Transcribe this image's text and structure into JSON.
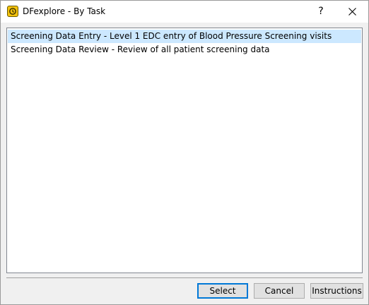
{
  "window": {
    "title": "DFexplore - By Task",
    "help_glyph": "?",
    "app_icon": "dfexplore-app-icon",
    "close_icon": "close-icon"
  },
  "task_list": {
    "items": [
      {
        "label": "Screening Data Entry - Level 1 EDC entry of Blood Pressure Screening visits",
        "selected": true
      },
      {
        "label": "Screening Data Review - Review of all patient screening data",
        "selected": false
      }
    ]
  },
  "buttons": {
    "select_label": "Select",
    "cancel_label": "Cancel",
    "instructions_label": "Instructions"
  },
  "colors": {
    "selection": "#cce8ff",
    "accent": "#0078d7",
    "icon_yellow": "#f3c20c"
  }
}
